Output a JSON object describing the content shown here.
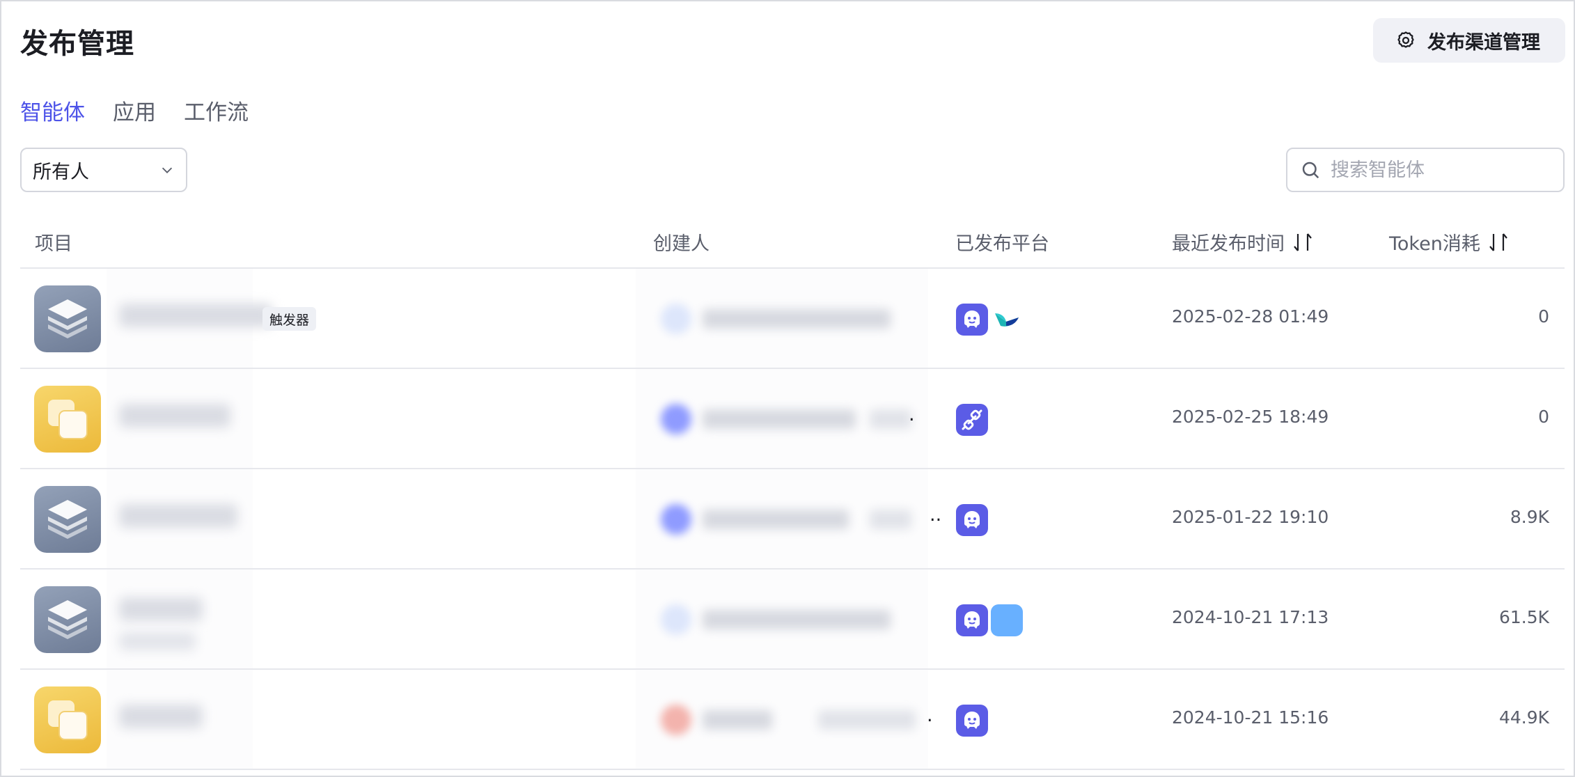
{
  "header": {
    "title": "发布管理",
    "channel_button": "发布渠道管理"
  },
  "tabs": [
    {
      "label": "智能体",
      "active": true
    },
    {
      "label": "应用",
      "active": false
    },
    {
      "label": "工作流",
      "active": false
    }
  ],
  "filter": {
    "owner_value": "所有人"
  },
  "search": {
    "placeholder": "搜索智能体",
    "value": ""
  },
  "table": {
    "columns": {
      "project": "项目",
      "creator": "创建人",
      "platforms": "已发布平台",
      "last_published": "最近发布时间",
      "tokens": "Token消耗"
    },
    "rows": [
      {
        "icon": "layers-icon",
        "tag": "触发器",
        "platforms": [
          "bot-platform-icon",
          "feishu-icon"
        ],
        "time": "2025-02-28 01:49",
        "tokens": "0"
      },
      {
        "icon": "squares-icon",
        "tag": "",
        "platforms": [
          "api-plugin-icon"
        ],
        "time": "2025-02-25 18:49",
        "tokens": "0"
      },
      {
        "icon": "layers-icon",
        "tag": "",
        "platforms": [
          "bot-platform-icon"
        ],
        "time": "2025-01-22 19:10",
        "tokens": "8.9K"
      },
      {
        "icon": "layers-icon",
        "tag": "",
        "platforms": [
          "bot-platform-icon",
          "blue-square-icon"
        ],
        "time": "2024-10-21 17:13",
        "tokens": "61.5K"
      },
      {
        "icon": "squares-icon",
        "tag": "",
        "platforms": [
          "bot-platform-icon"
        ],
        "time": "2024-10-21 15:16",
        "tokens": "44.9K"
      }
    ]
  },
  "colors": {
    "accent": "#4d53e8",
    "bot_platform": "#5b5ce6",
    "feishu_teal": "#1db5b5",
    "blue_square": "#68b0ff"
  }
}
